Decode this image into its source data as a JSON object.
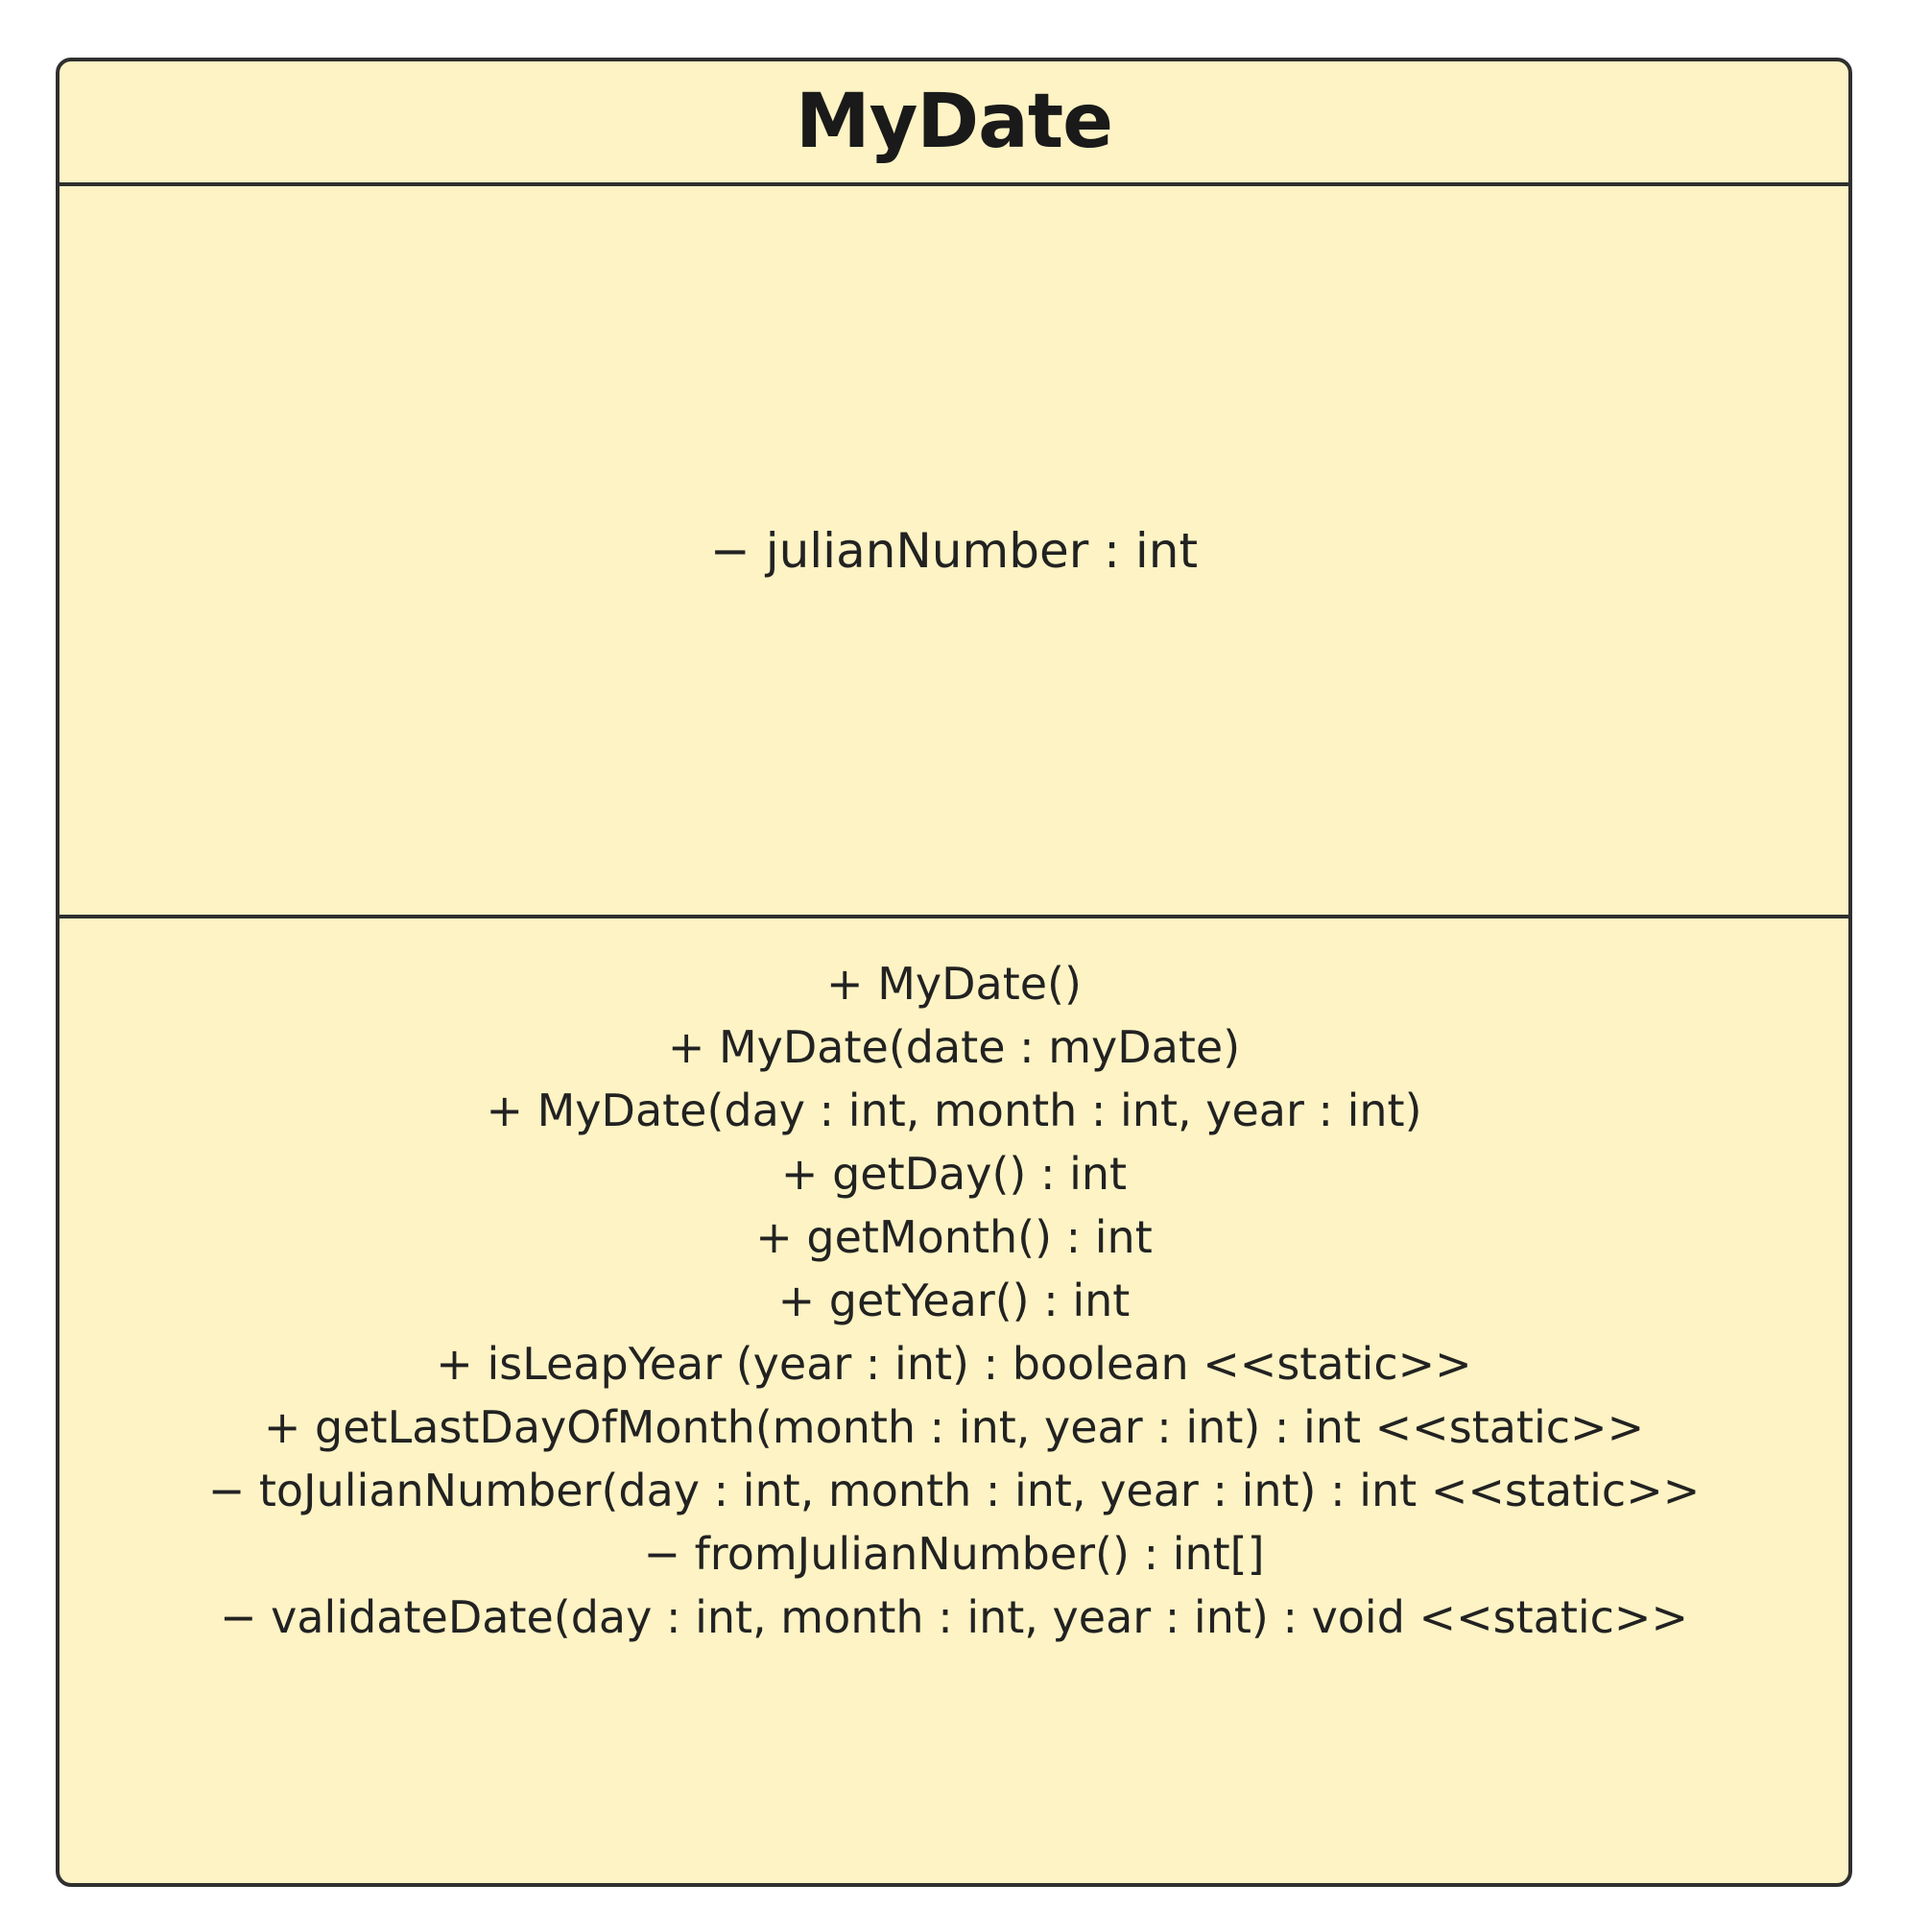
{
  "class": {
    "name": "MyDate",
    "attributes": [
      "− julianNumber : int"
    ],
    "operations": [
      "+ MyDate()",
      "+ MyDate(date : myDate)",
      "+ MyDate(day : int, month : int, year : int)",
      "+ getDay() : int",
      "+ getMonth() : int",
      "+ getYear() : int",
      "+ isLeapYear (year : int) : boolean <<static>>",
      "+ getLastDayOfMonth(month : int, year : int) : int <<static>>",
      "− toJulianNumber(day : int, month : int, year : int) : int <<static>>",
      "− fromJulianNumber() : int[]",
      "− validateDate(day : int, month : int, year : int) : void <<static>>"
    ]
  },
  "colors": {
    "fill": "#fdf3c4",
    "border": "#2f2f2f",
    "text": "#222222"
  }
}
